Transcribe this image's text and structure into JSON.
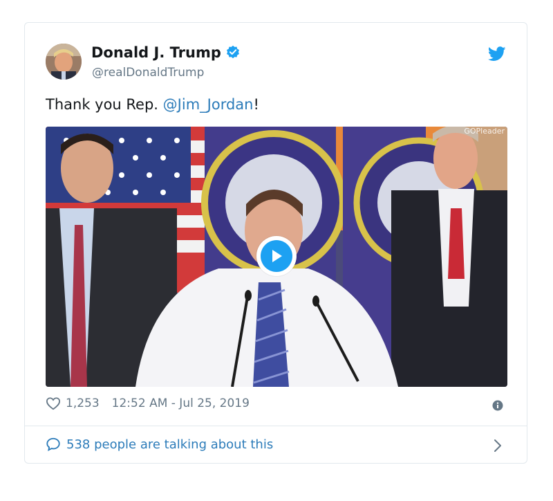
{
  "tweet": {
    "display_name": "Donald J. Trump",
    "handle": "@realDonaldTrump",
    "text_prefix": "Thank you Rep. ",
    "mention": "@Jim_Jordan",
    "text_suffix": "!",
    "likes": "1,253",
    "timestamp": "12:52 AM - Jul 25, 2019",
    "talking": "538 people are talking about this"
  },
  "media": {
    "watermark": "GOPleader"
  },
  "colors": {
    "accent": "#1da1f2",
    "link": "#2b7bb9",
    "muted": "#657786",
    "border": "#e1e8ed"
  },
  "icons": [
    "verified-badge-icon",
    "twitter-bird-icon",
    "play-icon",
    "heart-icon",
    "info-icon",
    "speech-bubble-icon",
    "chevron-right-icon"
  ]
}
